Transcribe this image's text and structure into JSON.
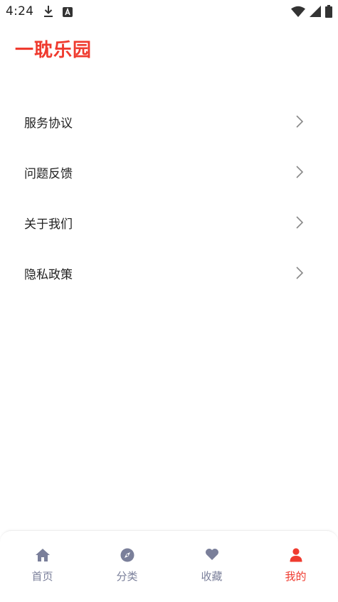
{
  "status_bar": {
    "time": "4:24",
    "left_icons": [
      "download-icon",
      "a-badge-icon"
    ],
    "right_icons": [
      "wifi-icon",
      "cell-signal-icon",
      "battery-icon"
    ]
  },
  "app": {
    "title": "一耽乐园",
    "accent_color": "#ef3b2f"
  },
  "menu": {
    "items": [
      {
        "label": "服务协议",
        "icon": "chevron-right-icon"
      },
      {
        "label": "问题反馈",
        "icon": "chevron-right-icon"
      },
      {
        "label": "关于我们",
        "icon": "chevron-right-icon"
      },
      {
        "label": "隐私政策",
        "icon": "chevron-right-icon"
      }
    ]
  },
  "tabbar": {
    "tabs": [
      {
        "label": "首页",
        "icon": "home-icon",
        "active": false
      },
      {
        "label": "分类",
        "icon": "compass-icon",
        "active": false
      },
      {
        "label": "收藏",
        "icon": "heart-icon",
        "active": false
      },
      {
        "label": "我的",
        "icon": "user-icon",
        "active": true
      }
    ],
    "inactive_color": "#7a7f9a",
    "active_color": "#ef3b2f"
  }
}
